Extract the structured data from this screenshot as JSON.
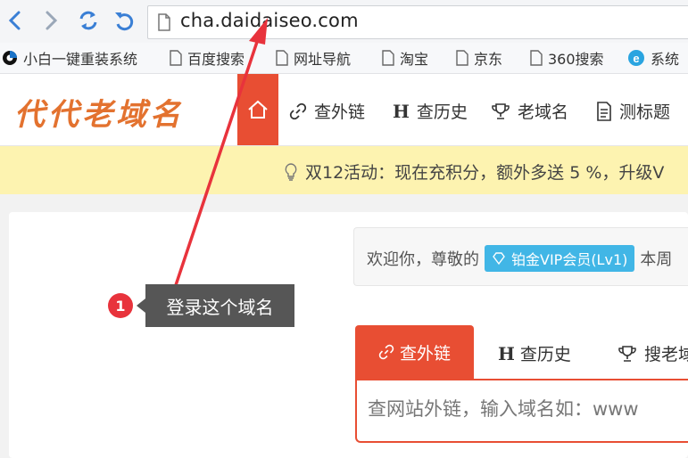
{
  "browser": {
    "url": "cha.daidaiseo.com",
    "buttons": {
      "back": "back",
      "forward": "forward",
      "refresh": "refresh",
      "undo": "undo"
    }
  },
  "bookmarks": [
    {
      "label": "小白一键重装系统",
      "icon": "xiaobai-icon"
    },
    {
      "label": "百度搜索",
      "icon": "page-icon"
    },
    {
      "label": "网址导航",
      "icon": "page-icon"
    },
    {
      "label": "淘宝",
      "icon": "page-icon"
    },
    {
      "label": "京东",
      "icon": "page-icon"
    },
    {
      "label": "360搜索",
      "icon": "page-icon"
    },
    {
      "label": "系统",
      "icon": "ie-icon"
    }
  ],
  "site": {
    "logo": "代代老域名",
    "nav": [
      {
        "label": "查外链",
        "icon": "link-icon"
      },
      {
        "label": "查历史",
        "icon": "H"
      },
      {
        "label": "老域名",
        "icon": "trophy-icon"
      },
      {
        "label": "测标题",
        "icon": "document-icon"
      }
    ]
  },
  "notice": {
    "text": "双12活动：现在充积分，额外多送 5 %，升级V"
  },
  "welcome": {
    "prefix": "欢迎你，尊敬的",
    "badge": "铂金VIP会员(Lv1)",
    "suffix": "本周"
  },
  "tabs": [
    {
      "label": "查外链",
      "icon": "link-icon",
      "active": true
    },
    {
      "label": "查历史",
      "icon": "H",
      "active": false
    },
    {
      "label": "搜老域",
      "icon": "trophy-icon",
      "active": false
    }
  ],
  "search": {
    "placeholder": "查网站外链，输入域名如：www"
  },
  "annotation": {
    "number": "1",
    "text": "登录这个域名"
  },
  "colors": {
    "accent": "#e84e33",
    "logo": "#e3722f",
    "notice_bg": "#fdf3b0",
    "vip": "#41b6e6",
    "annotation_red": "#e8333c"
  }
}
